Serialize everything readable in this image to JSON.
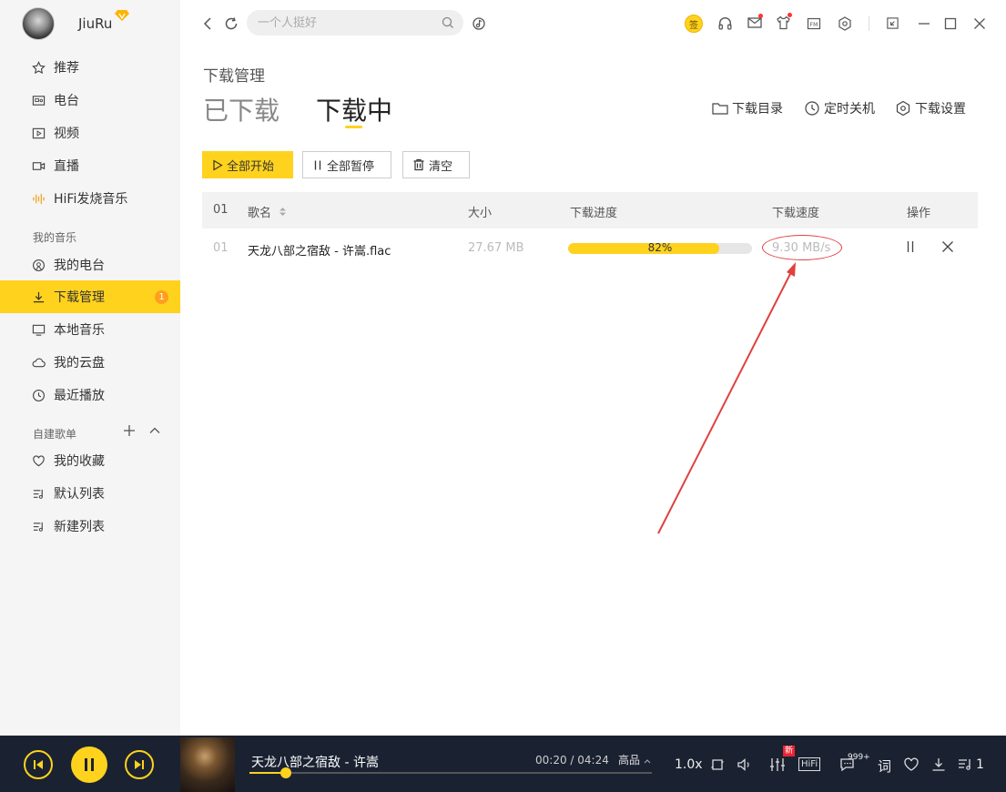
{
  "user": {
    "name": "JiuRu"
  },
  "nav": [
    {
      "label": "推荐",
      "icon": "star-icon"
    },
    {
      "label": "电台",
      "icon": "radio-icon"
    },
    {
      "label": "视频",
      "icon": "video-icon"
    },
    {
      "label": "直播",
      "icon": "live-camera-icon"
    },
    {
      "label": "HiFi发烧音乐",
      "icon": "waveform-icon"
    }
  ],
  "my_music": {
    "title": "我的音乐",
    "items": [
      {
        "label": "我的电台",
        "icon": "my-radio-icon"
      },
      {
        "label": "下载管理",
        "icon": "download-icon",
        "badge": "1",
        "active": true
      },
      {
        "label": "本地音乐",
        "icon": "monitor-icon"
      },
      {
        "label": "我的云盘",
        "icon": "cloud-icon"
      },
      {
        "label": "最近播放",
        "icon": "clock-icon"
      }
    ]
  },
  "playlists": {
    "title": "自建歌单",
    "add_label": "+",
    "items": [
      {
        "label": "我的收藏",
        "icon": "heart-icon"
      },
      {
        "label": "默认列表",
        "icon": "playlist-icon"
      },
      {
        "label": "新建列表",
        "icon": "playlist-icon"
      }
    ]
  },
  "topbar": {
    "search_placeholder": "一个人挺好",
    "sign_label": "签"
  },
  "page": {
    "breadcrumb": "下载管理",
    "tabs": [
      {
        "label": "已下载"
      },
      {
        "label": "下载中",
        "active": true
      }
    ],
    "actions": [
      {
        "label": "下载目录"
      },
      {
        "label": "定时关机"
      },
      {
        "label": "下载设置"
      }
    ],
    "buttons": {
      "start_all": "全部开始",
      "pause_all": "全部暂停",
      "clear": "清空"
    },
    "table": {
      "headers": {
        "index": "01",
        "name": "歌名",
        "size": "大小",
        "progress": "下载进度",
        "speed": "下载速度",
        "ops": "操作"
      },
      "rows": [
        {
          "index": "01",
          "name": "天龙八部之宿敌 - 许嵩.flac",
          "size": "27.67 MB",
          "progress": 82,
          "progress_label": "82%",
          "speed": "9.30 MB/s"
        }
      ]
    }
  },
  "player": {
    "song": "天龙八部之宿敌 - 许嵩",
    "time": "00:20 / 04:24",
    "quality": "高品",
    "rate": "1.0x",
    "new_tag": "新",
    "hifi": "HiFi",
    "comment_count": "999+",
    "lyric": "词",
    "queue_count": "1",
    "progress": 0.076
  },
  "colors": {
    "accent": "#ffd21e",
    "player_bg": "#1a2232",
    "annotation": "#e04040"
  }
}
